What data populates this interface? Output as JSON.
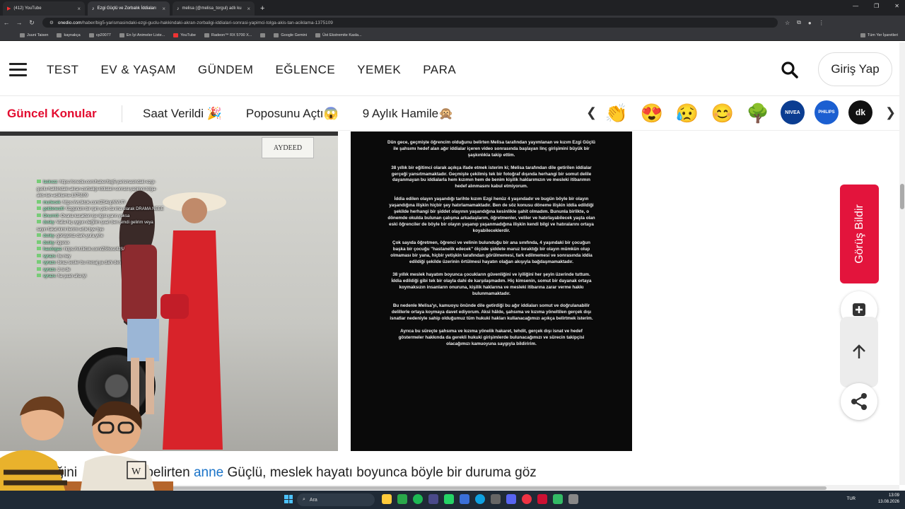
{
  "browser": {
    "tabs": [
      {
        "label": "(412) YouTube",
        "active": false
      },
      {
        "label": "Ezgi Güçlü ve Zorbalık İddiaları",
        "active": true
      },
      {
        "label": "melisa (@melisa_torgul) adlı ku",
        "active": false
      }
    ],
    "url_host": "onedio.com",
    "url_path": "/haber/big5-yarismasindaki-ezgi-guclu-hakkindaki-akran-zorbaligi-iddialari-sonrasi-yapimci-tolga-akis-tan-aciklama-1375109",
    "bookmarks": [
      "Juuni Taisen",
      "kaynakça",
      "cp20077",
      "En İyi Animeler Liste...",
      "YouTube",
      "Radeon™ RX 5700 X...",
      "",
      "Google Gemini",
      "Üst Ekstremite Kasla..."
    ],
    "bookmarks_right": "Tüm Yer İşaretleri"
  },
  "header": {
    "nav": [
      "TEST",
      "EV & YAŞAM",
      "GÜNDEM",
      "EĞLENCE",
      "YEMEK",
      "PARA"
    ],
    "login_label": "Giriş Yap"
  },
  "topics": {
    "title": "Güncel Konular",
    "items": [
      "Saat Verildi 🎉",
      "Poposunu Açtı😱",
      "9 Aylık Hamile🙊"
    ],
    "emojis": [
      "👏",
      "😍",
      "😥",
      "😊",
      "🌳"
    ],
    "brands": [
      "NIVEA",
      "PHILIPS",
      "dk"
    ]
  },
  "photo": {
    "sign": "AYDEED"
  },
  "chat": [
    {
      "user": "laskozz",
      "text": "https://onedio.com/haber/big5-yarismasindaki-ezgi-guclu-hakkindaki-akran-zorbaligi-iddialari-sonrasi-yapimci-tolga-akis-tan-aciklama-1375109"
    },
    {
      "user": "murlecek",
      "text": "https://vt.tiktok.com/ZS4opNVUT/"
    },
    {
      "user": "goldenest0",
      "text": "Üzgünüm bir işim çıktı da ima olarak DRAMA NEEE"
    },
    {
      "user": "Onurm3",
      "text": "Ovaria karakteri işe ilgisi yarın yoksa"
    },
    {
      "user": "dusky",
      "text": "Valla hiç uygun değilim şuan ben şimdi gelirim veya sayın fakat kimi ilerimi artık bye bye"
    },
    {
      "user": "dusky",
      "text": "görüşürüz dark yura yine"
    },
    {
      "user": "dusky",
      "text": "tigerex"
    },
    {
      "user": "haudogaz",
      "text": "https://vt.tiktok.com/ZS6osc4JS/"
    },
    {
      "user": "syrazs",
      "text": "bu ney"
    },
    {
      "user": "syrazs",
      "text": "biraz sesler bu mesaj ya dahi den"
    },
    {
      "user": "syrazs",
      "text": "2 si de"
    },
    {
      "user": "syrazs",
      "text": "ha şuan aha iyi"
    }
  ],
  "statement": [
    "Dün gece, geçmişte öğrencim olduğunu belirten Melisa tarafından yayımlanan ve kızım Ezgi Güçlü ile şahsımı hedef alan ağır iddialar içeren video sonrasında başlayan linç girişimini büyük bir şaşkınlıkla takip ettim.",
    "38 yıllık bir eğitimci olarak açıkça ifade etmek isterim ki; Melisa tarafından dile getirilen iddialar gerçeği yansıtmamaktadır. Geçmişte çekilmiş tek bir fotoğraf dışında herhangi bir somut delile dayanmayan bu iddialarla hem kızımın hem de benim kişilik haklarımızın ve mesleki itibarımın hedef alınmasını kabul etmiyorum.",
    "İddia edilen olayın yaşandığı tarihte kızım Ezgi henüz 4 yaşındadır ve bugün böyle bir olayın yaşandığına ilişkin hiçbir şey hatırlamamaktadır. Ben de söz konusu döneme ilişkin iddia edildiği şekilde herhangi bir şiddet olayının yaşandığına kesinlikle şahit olmadım. Bununla birlikte, o dönemde okulda bulunan çalışma arkadaşlarım, öğretmenler, veliler ve hatırlayabilecek yaşta olan eski öğrenciler de böyle bir olayın yaşanıp yaşanmadığına ilişkin kendi bilgi ve hatıralarını ortaya koyabileceklerdir.",
    "Çok sayıda öğretmen, öğrenci ve velinin bulunduğu bir ana sınıfında, 4 yaşındaki bir çocuğun başka bir çocuğu \"hastanelik edecek\" ölçüde şiddete maruz bıraktığı bir olayın mümkün olup olmaması bir yana, hiçbir yetişkin tarafından görülmemesi, fark edilmemesi ve sonrasında iddia edildiği şekilde üzerinin örtülmesi hayatın olağan akışıyla bağdaşmamaktadır.",
    "38 yıllık meslek hayatım boyunca çocukların güvenliğini ve iyiliğini her şeyin üzerinde tuttum. İddia edildiği gibi tek bir olayla dahi de karşılaşmadım. Hiç kimsenin, somut bir dayanak ortaya koymaksızın insanların onuruna, kişilik haklarına ve mesleki itibarına zarar verme hakkı bulunmamaktadır.",
    "Bu nedenle Melisa'yı, kamuoyu önünde dile getirdiği bu ağır iddiaları somut ve doğrulanabilir delillerle ortaya koymaya davet ediyorum. Aksi hâlde, şahsıma ve kızıma yöneltilen gerçek dışı isnatlar nedeniyle sahip olduğumuz tüm hukuki hakları kullanacağımızı açıkça belirtmek isterim.",
    "Ayrıca bu süreçte şahsıma ve kızıma yönelik hakaret, tehdit, gerçek dışı isnat ve hedef göstermeler hakkında da gerekli hukuki girişimlerde bulunacağımızı ve sürecin takipçisi olacağımızı kamuoyuna saygıyla bildiririm."
  ],
  "article": {
    "before": "tiğini",
    "middle": "belirten",
    "link": "anne",
    "after": "Güçlü, meslek hayatı boyunca böyle bir duruma göz"
  },
  "side": {
    "feedback_label": "Görüş Bildir"
  },
  "taskbar": {
    "search_placeholder": "Ara",
    "lang": "TUR",
    "time": "13:09",
    "date": "13.08.2026"
  },
  "colors": {
    "accent": "#e30b2f",
    "link": "#1a73c8"
  }
}
